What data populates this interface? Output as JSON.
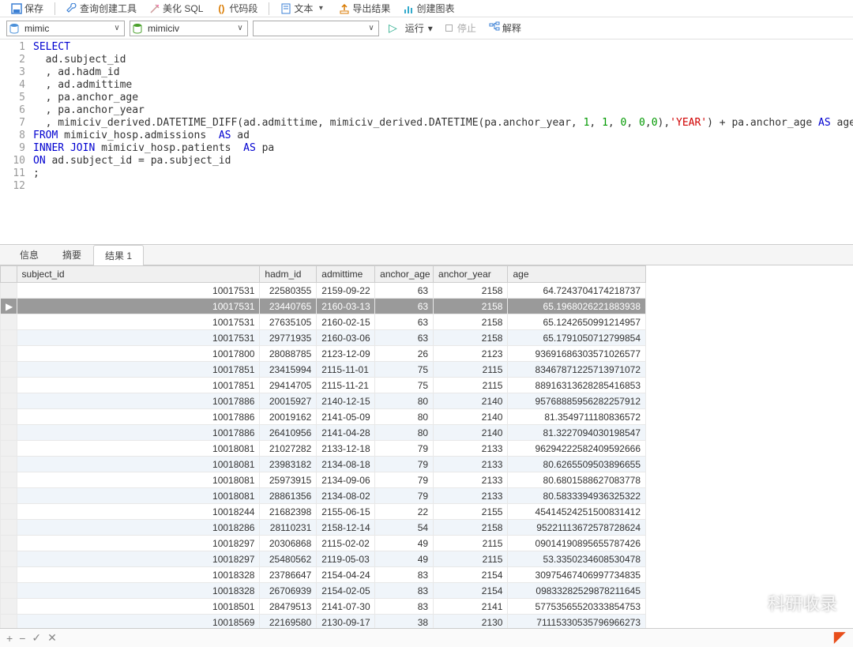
{
  "toolbar": {
    "save": "保存",
    "query_tool": "查询创建工具",
    "beautify": "美化 SQL",
    "code_snip": "代码段",
    "text": "文本",
    "export": "导出结果",
    "chart": "创建图表"
  },
  "conn": {
    "conn1": "mimic",
    "conn2": "mimiciv",
    "conn3": "",
    "run": "运行",
    "stop": "停止",
    "explain": "解释"
  },
  "code_lines": [
    {
      "n": "1",
      "html": "<span class='kw'>SELECT</span>"
    },
    {
      "n": "2",
      "html": "  ad.subject_id"
    },
    {
      "n": "3",
      "html": "  , ad.hadm_id"
    },
    {
      "n": "4",
      "html": "  , ad.admittime"
    },
    {
      "n": "5",
      "html": "  , pa.anchor_age"
    },
    {
      "n": "6",
      "html": "  , pa.anchor_year"
    },
    {
      "n": "7",
      "html": "  , mimiciv_derived.DATETIME_DIFF(ad.admittime, mimiciv_derived.DATETIME(pa.anchor_year, <span class='num'>1</span>, <span class='num'>1</span>, <span class='num'>0</span>, <span class='num'>0</span>,<span class='num'>0</span>),<span class='str'>'YEAR'</span>) + pa.anchor_age <span class='kw'>AS</span> age"
    },
    {
      "n": "8",
      "html": "<span class='kw'>FROM</span> mimiciv_hosp.admissions  <span class='kw'>AS</span> ad"
    },
    {
      "n": "9",
      "html": "<span class='kw'>INNER JOIN</span> mimiciv_hosp.patients  <span class='kw'>AS</span> pa"
    },
    {
      "n": "10",
      "html": "<span class='kw'>ON</span> ad.subject_id = pa.subject_id"
    },
    {
      "n": "11",
      "html": ";"
    },
    {
      "n": "12",
      "html": ""
    }
  ],
  "tabs": {
    "info": "信息",
    "summary": "摘要",
    "result": "结果 1"
  },
  "columns": [
    "subject_id",
    "hadm_id",
    "admittime",
    "anchor_age",
    "anchor_year",
    "age"
  ],
  "rows": [
    {
      "subject_id": "10017531",
      "hadm_id": "22580355",
      "admittime": "2159-09-22",
      "anchor_age": "63",
      "anchor_year": "2158",
      "age": "64.7243704174218737"
    },
    {
      "subject_id": "10017531",
      "hadm_id": "23440765",
      "admittime": "2160-03-13",
      "anchor_age": "63",
      "anchor_year": "2158",
      "age": "65.1968026221883938",
      "sel": true
    },
    {
      "subject_id": "10017531",
      "hadm_id": "27635105",
      "admittime": "2160-02-15",
      "anchor_age": "63",
      "anchor_year": "2158",
      "age": "65.1242650991214957"
    },
    {
      "subject_id": "10017531",
      "hadm_id": "29771935",
      "admittime": "2160-03-06",
      "anchor_age": "63",
      "anchor_year": "2158",
      "age": "65.1791050712799854"
    },
    {
      "subject_id": "10017800",
      "hadm_id": "28088785",
      "admittime": "2123-12-09",
      "anchor_age": "26",
      "anchor_year": "2123",
      "age": "93691686303571026577"
    },
    {
      "subject_id": "10017851",
      "hadm_id": "23415994",
      "admittime": "2115-11-01",
      "anchor_age": "75",
      "anchor_year": "2115",
      "age": "83467871225713971072"
    },
    {
      "subject_id": "10017851",
      "hadm_id": "29414705",
      "admittime": "2115-11-21",
      "anchor_age": "75",
      "anchor_year": "2115",
      "age": "88916313628285416853"
    },
    {
      "subject_id": "10017886",
      "hadm_id": "20015927",
      "admittime": "2140-12-15",
      "anchor_age": "80",
      "anchor_year": "2140",
      "age": "95768885956282257912"
    },
    {
      "subject_id": "10017886",
      "hadm_id": "20019162",
      "admittime": "2141-05-09",
      "anchor_age": "80",
      "anchor_year": "2140",
      "age": "81.3549711180836572"
    },
    {
      "subject_id": "10017886",
      "hadm_id": "26410956",
      "admittime": "2141-04-28",
      "anchor_age": "80",
      "anchor_year": "2140",
      "age": "81.3227094030198547"
    },
    {
      "subject_id": "10018081",
      "hadm_id": "21027282",
      "admittime": "2133-12-18",
      "anchor_age": "79",
      "anchor_year": "2133",
      "age": "96294222582409592666"
    },
    {
      "subject_id": "10018081",
      "hadm_id": "23983182",
      "admittime": "2134-08-18",
      "anchor_age": "79",
      "anchor_year": "2133",
      "age": "80.6265509503896655"
    },
    {
      "subject_id": "10018081",
      "hadm_id": "25973915",
      "admittime": "2134-09-06",
      "anchor_age": "79",
      "anchor_year": "2133",
      "age": "80.6801588627083778"
    },
    {
      "subject_id": "10018081",
      "hadm_id": "28861356",
      "admittime": "2134-08-02",
      "anchor_age": "79",
      "anchor_year": "2133",
      "age": "80.5833394936325322"
    },
    {
      "subject_id": "10018244",
      "hadm_id": "21682398",
      "admittime": "2155-06-15",
      "anchor_age": "22",
      "anchor_year": "2155",
      "age": "45414524251500831412"
    },
    {
      "subject_id": "10018286",
      "hadm_id": "28110231",
      "admittime": "2158-12-14",
      "anchor_age": "54",
      "anchor_year": "2158",
      "age": "95221113672578728624"
    },
    {
      "subject_id": "10018297",
      "hadm_id": "20306868",
      "admittime": "2115-02-02",
      "anchor_age": "49",
      "anchor_year": "2115",
      "age": "09014190895655787426"
    },
    {
      "subject_id": "10018297",
      "hadm_id": "25480562",
      "admittime": "2119-05-03",
      "anchor_age": "49",
      "anchor_year": "2115",
      "age": "53.3350234608530478"
    },
    {
      "subject_id": "10018328",
      "hadm_id": "23786647",
      "admittime": "2154-04-24",
      "anchor_age": "83",
      "anchor_year": "2154",
      "age": "30975467406997734835"
    },
    {
      "subject_id": "10018328",
      "hadm_id": "26706939",
      "admittime": "2154-02-05",
      "anchor_age": "83",
      "anchor_year": "2154",
      "age": "09833282529878211645"
    },
    {
      "subject_id": "10018501",
      "hadm_id": "28479513",
      "admittime": "2141-07-30",
      "anchor_age": "83",
      "anchor_year": "2141",
      "age": "57753565520333854753"
    },
    {
      "subject_id": "10018569",
      "hadm_id": "22169580",
      "admittime": "2130-09-17",
      "anchor_age": "38",
      "anchor_year": "2130",
      "age": "71115330535796966273"
    }
  ],
  "watermark": "科研收录"
}
